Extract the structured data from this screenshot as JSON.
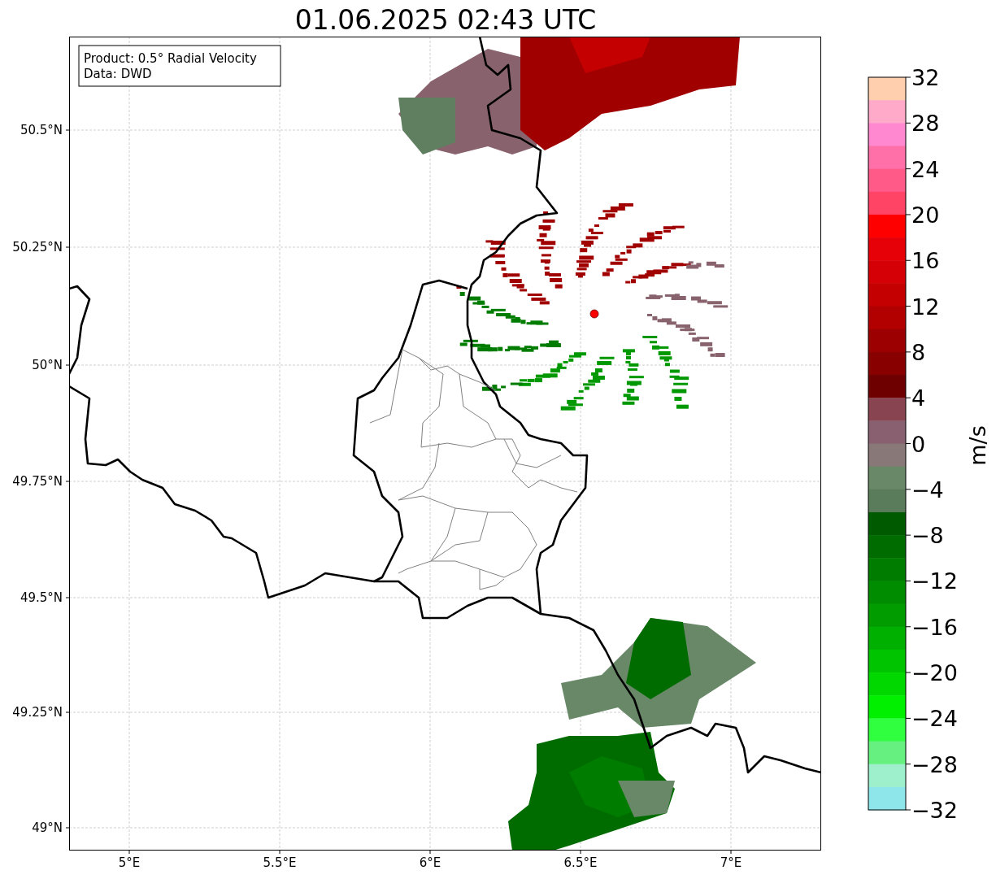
{
  "title": "01.06.2025 02:43 UTC",
  "info_box": [
    "Product: 0.5° Radial Velocity",
    "Data: DWD"
  ],
  "lat_ticks": [
    "50.5°N",
    "50.25°N",
    "50°N",
    "49.75°N",
    "49.5°N",
    "49.25°N",
    "49°N"
  ],
  "lon_ticks": [
    "5°E",
    "5.5°E",
    "6°E",
    "6.5°E",
    "7°E"
  ],
  "colorbar": {
    "label": "m/s",
    "ticks": [
      "32",
      "28",
      "24",
      "20",
      "16",
      "12",
      "8",
      "4",
      "0",
      "−4",
      "−8",
      "−12",
      "−16",
      "−20",
      "−24",
      "−28",
      "−32"
    ],
    "segments": [
      {
        "color": "#ffcfae"
      },
      {
        "color": "#ffaac8"
      },
      {
        "color": "#ff88d0"
      },
      {
        "color": "#ff70a8"
      },
      {
        "color": "#ff5a88"
      },
      {
        "color": "#ff4466"
      },
      {
        "color": "#ff0000"
      },
      {
        "color": "#e60008"
      },
      {
        "color": "#d40006"
      },
      {
        "color": "#c40000"
      },
      {
        "color": "#b20000"
      },
      {
        "color": "#9c0000"
      },
      {
        "color": "#880000"
      },
      {
        "color": "#6e0000"
      },
      {
        "color": "#884450"
      },
      {
        "color": "#886070"
      },
      {
        "color": "#887878"
      },
      {
        "color": "#688868"
      },
      {
        "color": "#5a7c5a"
      },
      {
        "color": "#005a00"
      },
      {
        "color": "#006c00"
      },
      {
        "color": "#007c00"
      },
      {
        "color": "#008c00"
      },
      {
        "color": "#009c00"
      },
      {
        "color": "#00b000"
      },
      {
        "color": "#00c400"
      },
      {
        "color": "#00d800"
      },
      {
        "color": "#00f000"
      },
      {
        "color": "#30ff40"
      },
      {
        "color": "#66f080"
      },
      {
        "color": "#9ef0cc"
      },
      {
        "color": "#8ee6ea"
      }
    ]
  }
}
